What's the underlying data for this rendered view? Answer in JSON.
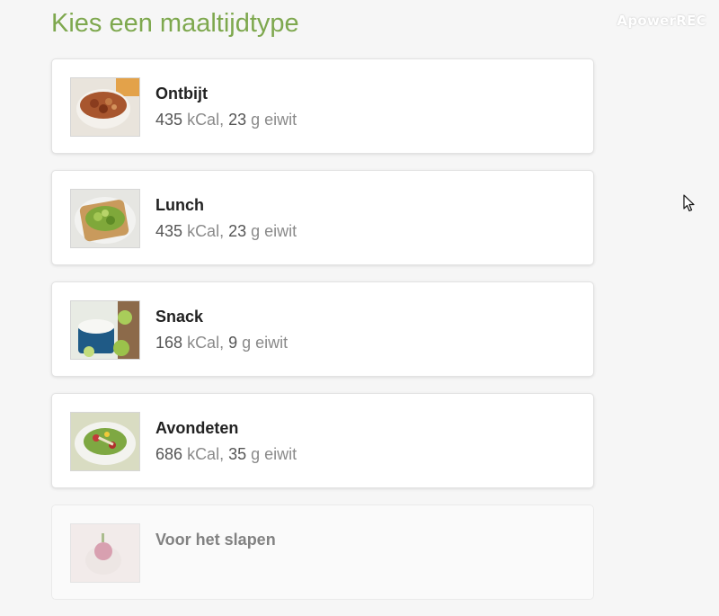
{
  "watermark": "ApowerREC",
  "page": {
    "title": "Kies een maaltijdtype"
  },
  "meals": [
    {
      "name": "Ontbijt",
      "kcal": "435",
      "kcal_unit": "kCal,",
      "protein": "23",
      "protein_unit": "g eiwit",
      "image": "oatmeal-bowl"
    },
    {
      "name": "Lunch",
      "kcal": "435",
      "kcal_unit": "kCal,",
      "protein": "23",
      "protein_unit": "g eiwit",
      "image": "avocado-toast"
    },
    {
      "name": "Snack",
      "kcal": "168",
      "kcal_unit": "kCal,",
      "protein": "9",
      "protein_unit": "g eiwit",
      "image": "yogurt-dip"
    },
    {
      "name": "Avondeten",
      "kcal": "686",
      "kcal_unit": "kCal,",
      "protein": "35",
      "protein_unit": "g eiwit",
      "image": "salad-plate"
    },
    {
      "name": "Voor het slapen",
      "image": "berry-dessert"
    }
  ],
  "cursor_icon": "mouse-pointer-icon"
}
